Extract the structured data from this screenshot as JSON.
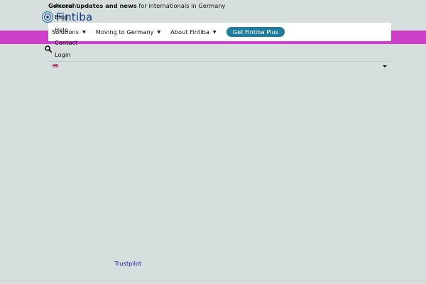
{
  "topbar": {
    "prefix": "General updates and news",
    "suffix": "for internationals in Germany"
  },
  "overlay_links": [
    "Account",
    "Blog",
    "Help",
    "Contact",
    "Login"
  ],
  "logo": {
    "text": "Fintiba"
  },
  "nav": {
    "items": [
      {
        "label": "Solutions"
      },
      {
        "label": "Moving to Germany"
      },
      {
        "label": "About Fintiba"
      }
    ],
    "cta": "Get Fintiba Plus"
  },
  "language": {
    "icon": "uk-flag-icon"
  },
  "footer": {
    "trustpilot": "Trustpilot"
  },
  "colors": {
    "background": "#d7dfde",
    "accent_band": "#cc41c8",
    "cta": "#1f7c9a",
    "logo_text": "#0d3a87",
    "link": "#1a1aa6"
  }
}
